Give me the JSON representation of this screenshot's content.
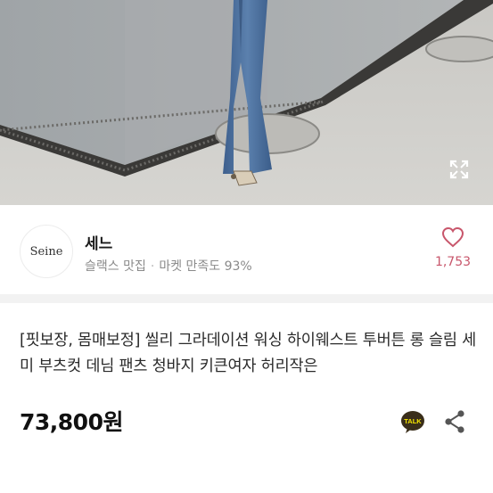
{
  "hero": {
    "image_description_icon": "product-photo",
    "expand_icon": "expand-icon"
  },
  "seller": {
    "logo_text": "Seine",
    "name": "세느",
    "tagline": "슬랙스 맛집",
    "satisfaction": "마켓 만족도 93%",
    "like_icon": "heart-icon",
    "like_count": "1,753"
  },
  "product": {
    "title": "[핏보장, 몸매보정] 씰리 그라데이션 워싱 하이웨스트 투버튼 롱 슬림 세미 부츠컷 데님 팬츠 청바지 키큰여자 허리작은",
    "price": "73,800원",
    "talk_label": "TALK",
    "talk_icon": "kakao-talk-icon",
    "share_icon": "share-icon"
  },
  "colors": {
    "like_accent": "#c8566b",
    "talk_yellow": "#3a2e1a"
  }
}
